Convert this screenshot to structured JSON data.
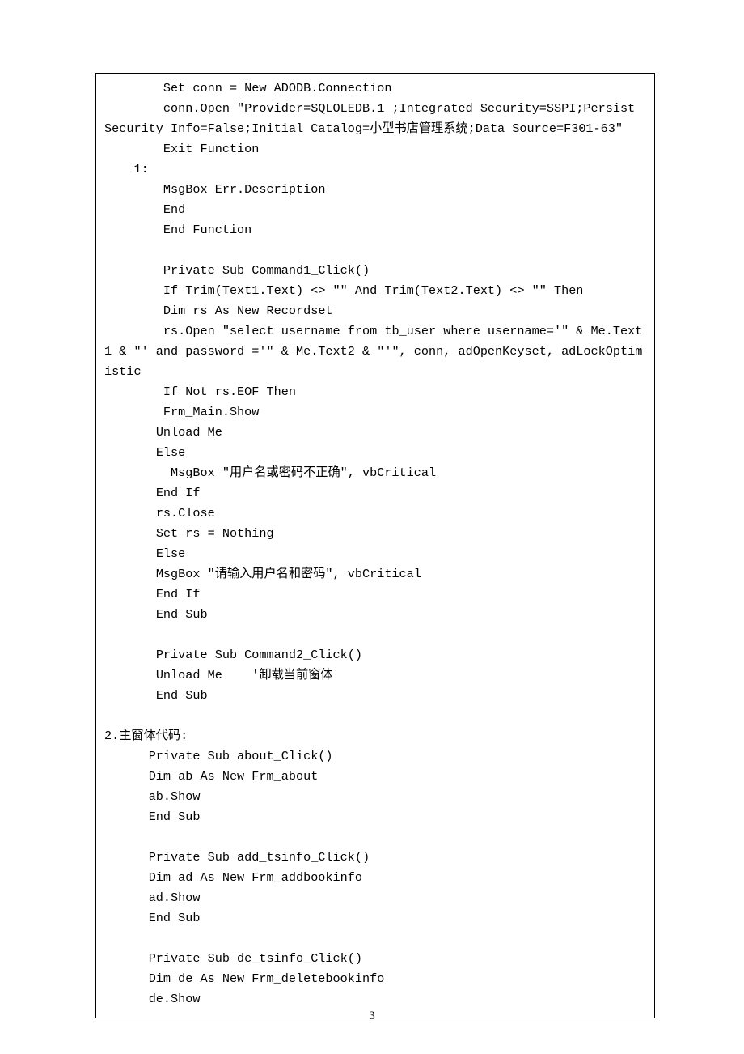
{
  "page_number": "3",
  "code_lines": [
    "        Set conn = New ADODB.Connection",
    "        conn.Open \"Provider=SQLOLEDB.1 ;Integrated Security=SSPI;Persist Security Info=False;Initial Catalog=小型书店管理系统;Data Source=F301-63\"",
    "        Exit Function",
    "    1:",
    "        MsgBox Err.Description",
    "        End",
    "        End Function",
    "",
    "        Private Sub Command1_Click()",
    "        If Trim(Text1.Text) <> \"\" And Trim(Text2.Text) <> \"\" Then",
    "        Dim rs As New Recordset",
    "        rs.Open \"select username from tb_user where username='\" & Me.Text1 & \"' and password ='\" & Me.Text2 & \"'\", conn, adOpenKeyset, adLockOptimistic",
    "        If Not rs.EOF Then",
    "        Frm_Main.Show",
    "       Unload Me",
    "       Else",
    "         MsgBox \"用户名或密码不正确\", vbCritical",
    "       End If",
    "       rs.Close",
    "       Set rs = Nothing",
    "       Else",
    "       MsgBox \"请输入用户名和密码\", vbCritical",
    "       End If",
    "       End Sub",
    "",
    "       Private Sub Command2_Click()",
    "       Unload Me    '卸载当前窗体",
    "       End Sub",
    "",
    "2.主窗体代码:",
    "      Private Sub about_Click()",
    "      Dim ab As New Frm_about",
    "      ab.Show",
    "      End Sub",
    "",
    "      Private Sub add_tsinfo_Click()",
    "      Dim ad As New Frm_addbookinfo",
    "      ad.Show",
    "      End Sub",
    "",
    "      Private Sub de_tsinfo_Click()",
    "      Dim de As New Frm_deletebookinfo",
    "      de.Show"
  ]
}
